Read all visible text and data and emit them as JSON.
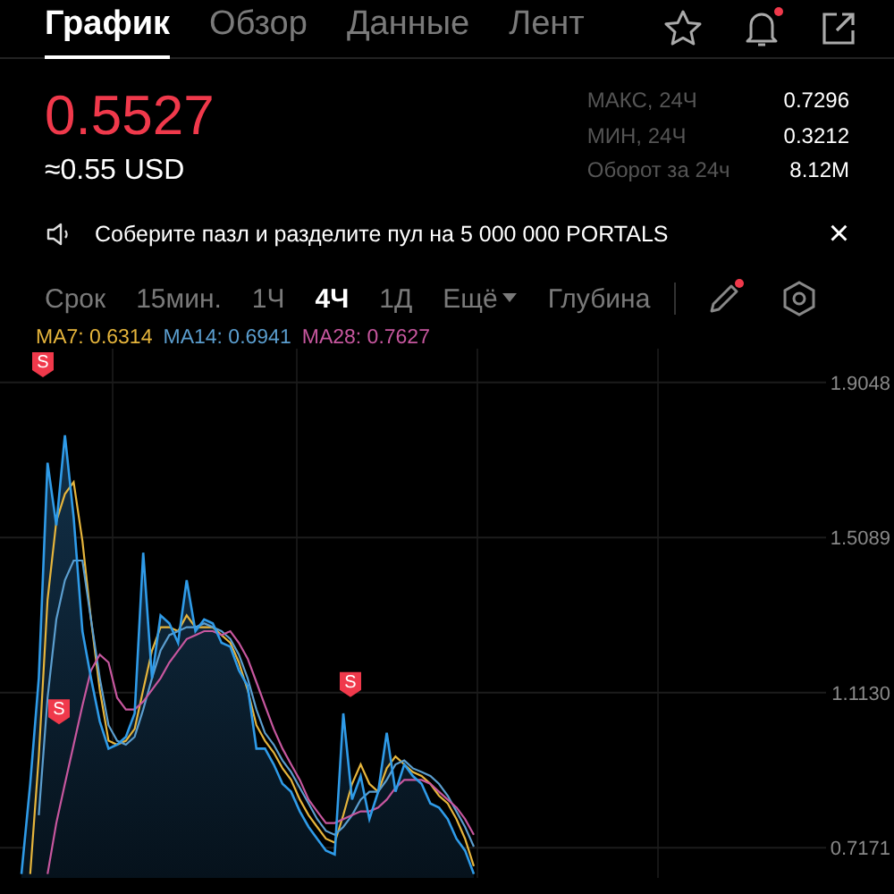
{
  "tabs": [
    {
      "label": "График",
      "selected": true
    },
    {
      "label": "Обзор",
      "selected": false
    },
    {
      "label": "Данные",
      "selected": false
    },
    {
      "label": "Лент",
      "selected": false
    }
  ],
  "header_icons": {
    "bell_alert": true
  },
  "price": {
    "last": "0.5527",
    "usd": "≈0.55 USD"
  },
  "stats": [
    {
      "label": "МАКС, 24Ч",
      "value": "0.7296"
    },
    {
      "label": "МИН, 24Ч",
      "value": "0.3212"
    },
    {
      "label": "Оборот за 24ч",
      "value": "8.12M"
    }
  ],
  "banner": {
    "text": "Соберите пазл и разделите пул на 5 000 000 PORTALS",
    "close": "×"
  },
  "intervals": [
    {
      "label": "Срок",
      "kind": "label"
    },
    {
      "label": "15мин.",
      "kind": "option",
      "selected": false
    },
    {
      "label": "1Ч",
      "kind": "option",
      "selected": false
    },
    {
      "label": "4Ч",
      "kind": "option",
      "selected": true
    },
    {
      "label": "1Д",
      "kind": "option",
      "selected": false
    },
    {
      "label": "Ещё",
      "kind": "dropdown",
      "selected": false
    },
    {
      "label": "Глубина",
      "kind": "option",
      "selected": false
    }
  ],
  "draw_tool_alert": true,
  "sell_markers": [
    {
      "text": "S"
    },
    {
      "text": "S"
    },
    {
      "text": "S"
    }
  ],
  "ma_legend": [
    {
      "reading": ": 0.6314"
    },
    {
      "reading": ": 0.6941"
    },
    {
      "reading": ": 0.7627"
    }
  ],
  "chart": {
    "chart_data": {
      "type": "line",
      "grid": true,
      "categories": [
        null,
        null,
        null,
        null,
        null,
        null,
        null,
        null,
        null,
        null,
        null,
        null,
        null,
        null,
        null,
        null,
        null,
        null,
        null,
        null,
        null,
        null,
        null,
        null,
        null,
        null,
        null,
        null,
        null,
        null,
        null,
        null,
        null,
        null,
        null,
        null,
        null,
        null,
        null,
        null,
        null,
        null,
        null,
        null,
        null,
        null,
        null,
        null,
        null,
        null,
        null,
        null,
        null
      ],
      "ylim": [
        0.64,
        1.991
      ],
      "yticks": [
        {
          "value": 1.9048,
          "label": "1.9048"
        },
        {
          "value": 1.5089,
          "label": "1.5089"
        },
        {
          "value": 1.113,
          "label": "1.1130"
        },
        {
          "value": 0.7171,
          "label": "0.7171"
        }
      ],
      "series": [
        {
          "type": "area",
          "color": "#2f9be8",
          "values": [
            0.65,
            0.88,
            1.15,
            1.7,
            1.54,
            1.77,
            1.56,
            1.27,
            1.15,
            1.04,
            0.97,
            0.98,
            1.0,
            1.06,
            1.47,
            1.15,
            1.31,
            1.29,
            1.24,
            1.4,
            1.27,
            1.3,
            1.29,
            1.24,
            1.23,
            1.17,
            1.13,
            0.97,
            0.97,
            0.93,
            0.88,
            0.86,
            0.81,
            0.77,
            0.74,
            0.71,
            0.7,
            1.06,
            0.84,
            0.9,
            0.79,
            0.86,
            1.01,
            0.86,
            0.93,
            0.9,
            0.88,
            0.83,
            0.82,
            0.79,
            0.74,
            0.71,
            0.65
          ]
        },
        {
          "name": "MA7",
          "type": "line",
          "color": "#e6b53c",
          "values": [
            null,
            0.65,
            0.95,
            1.35,
            1.55,
            1.62,
            1.65,
            1.5,
            1.3,
            1.12,
            0.99,
            0.98,
            0.99,
            1.02,
            1.12,
            1.22,
            1.28,
            1.28,
            1.27,
            1.31,
            1.28,
            1.28,
            1.28,
            1.26,
            1.24,
            1.19,
            1.12,
            1.03,
            0.99,
            0.96,
            0.92,
            0.89,
            0.84,
            0.8,
            0.77,
            0.74,
            0.73,
            0.8,
            0.88,
            0.93,
            0.88,
            0.86,
            0.92,
            0.95,
            0.93,
            0.91,
            0.9,
            0.88,
            0.85,
            0.83,
            0.79,
            0.74,
            0.67
          ]
        },
        {
          "name": "MA14",
          "type": "line",
          "color": "#5b9ecf",
          "values": [
            null,
            null,
            0.8,
            1.1,
            1.3,
            1.4,
            1.45,
            1.45,
            1.3,
            1.15,
            1.03,
            0.99,
            0.98,
            1.0,
            1.07,
            1.15,
            1.22,
            1.26,
            1.27,
            1.28,
            1.28,
            1.29,
            1.28,
            1.27,
            1.25,
            1.21,
            1.15,
            1.07,
            1.01,
            0.98,
            0.94,
            0.91,
            0.87,
            0.83,
            0.79,
            0.76,
            0.75,
            0.77,
            0.8,
            0.84,
            0.86,
            0.86,
            0.89,
            0.93,
            0.94,
            0.92,
            0.91,
            0.9,
            0.88,
            0.85,
            0.81,
            0.77,
            0.72
          ]
        },
        {
          "name": "MA28",
          "type": "line",
          "color": "#c7579f",
          "values": [
            null,
            null,
            null,
            0.65,
            0.78,
            0.88,
            0.98,
            1.08,
            1.17,
            1.21,
            1.19,
            1.1,
            1.07,
            1.07,
            1.09,
            1.12,
            1.15,
            1.19,
            1.22,
            1.25,
            1.26,
            1.27,
            1.27,
            1.26,
            1.27,
            1.24,
            1.2,
            1.14,
            1.08,
            1.02,
            0.97,
            0.93,
            0.89,
            0.84,
            0.81,
            0.78,
            0.78,
            0.79,
            0.8,
            0.81,
            0.81,
            0.82,
            0.84,
            0.87,
            0.89,
            0.89,
            0.89,
            0.88,
            0.86,
            0.84,
            0.82,
            0.79,
            0.75
          ]
        }
      ]
    }
  }
}
